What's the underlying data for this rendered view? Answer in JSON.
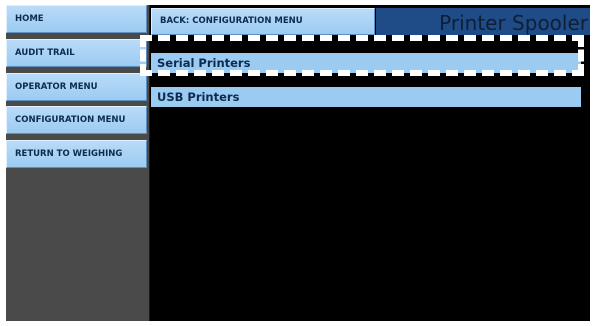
{
  "sidebar": {
    "items": [
      {
        "label": "HOME"
      },
      {
        "label": "AUDIT TRAIL"
      },
      {
        "label": "OPERATOR MENU"
      },
      {
        "label": "CONFIGURATION MENU"
      },
      {
        "label": "RETURN TO WEIGHING"
      }
    ]
  },
  "header": {
    "back_label": "BACK: CONFIGURATION MENU",
    "title": "Printer Spooler"
  },
  "list": {
    "items": [
      {
        "label": "Serial Printers"
      },
      {
        "label": "USB Printers"
      }
    ]
  },
  "colors": {
    "button": "#9ccbf2",
    "title_bar": "#1f4c86",
    "background": "#000000",
    "sidebar": "#4a4a4a"
  }
}
